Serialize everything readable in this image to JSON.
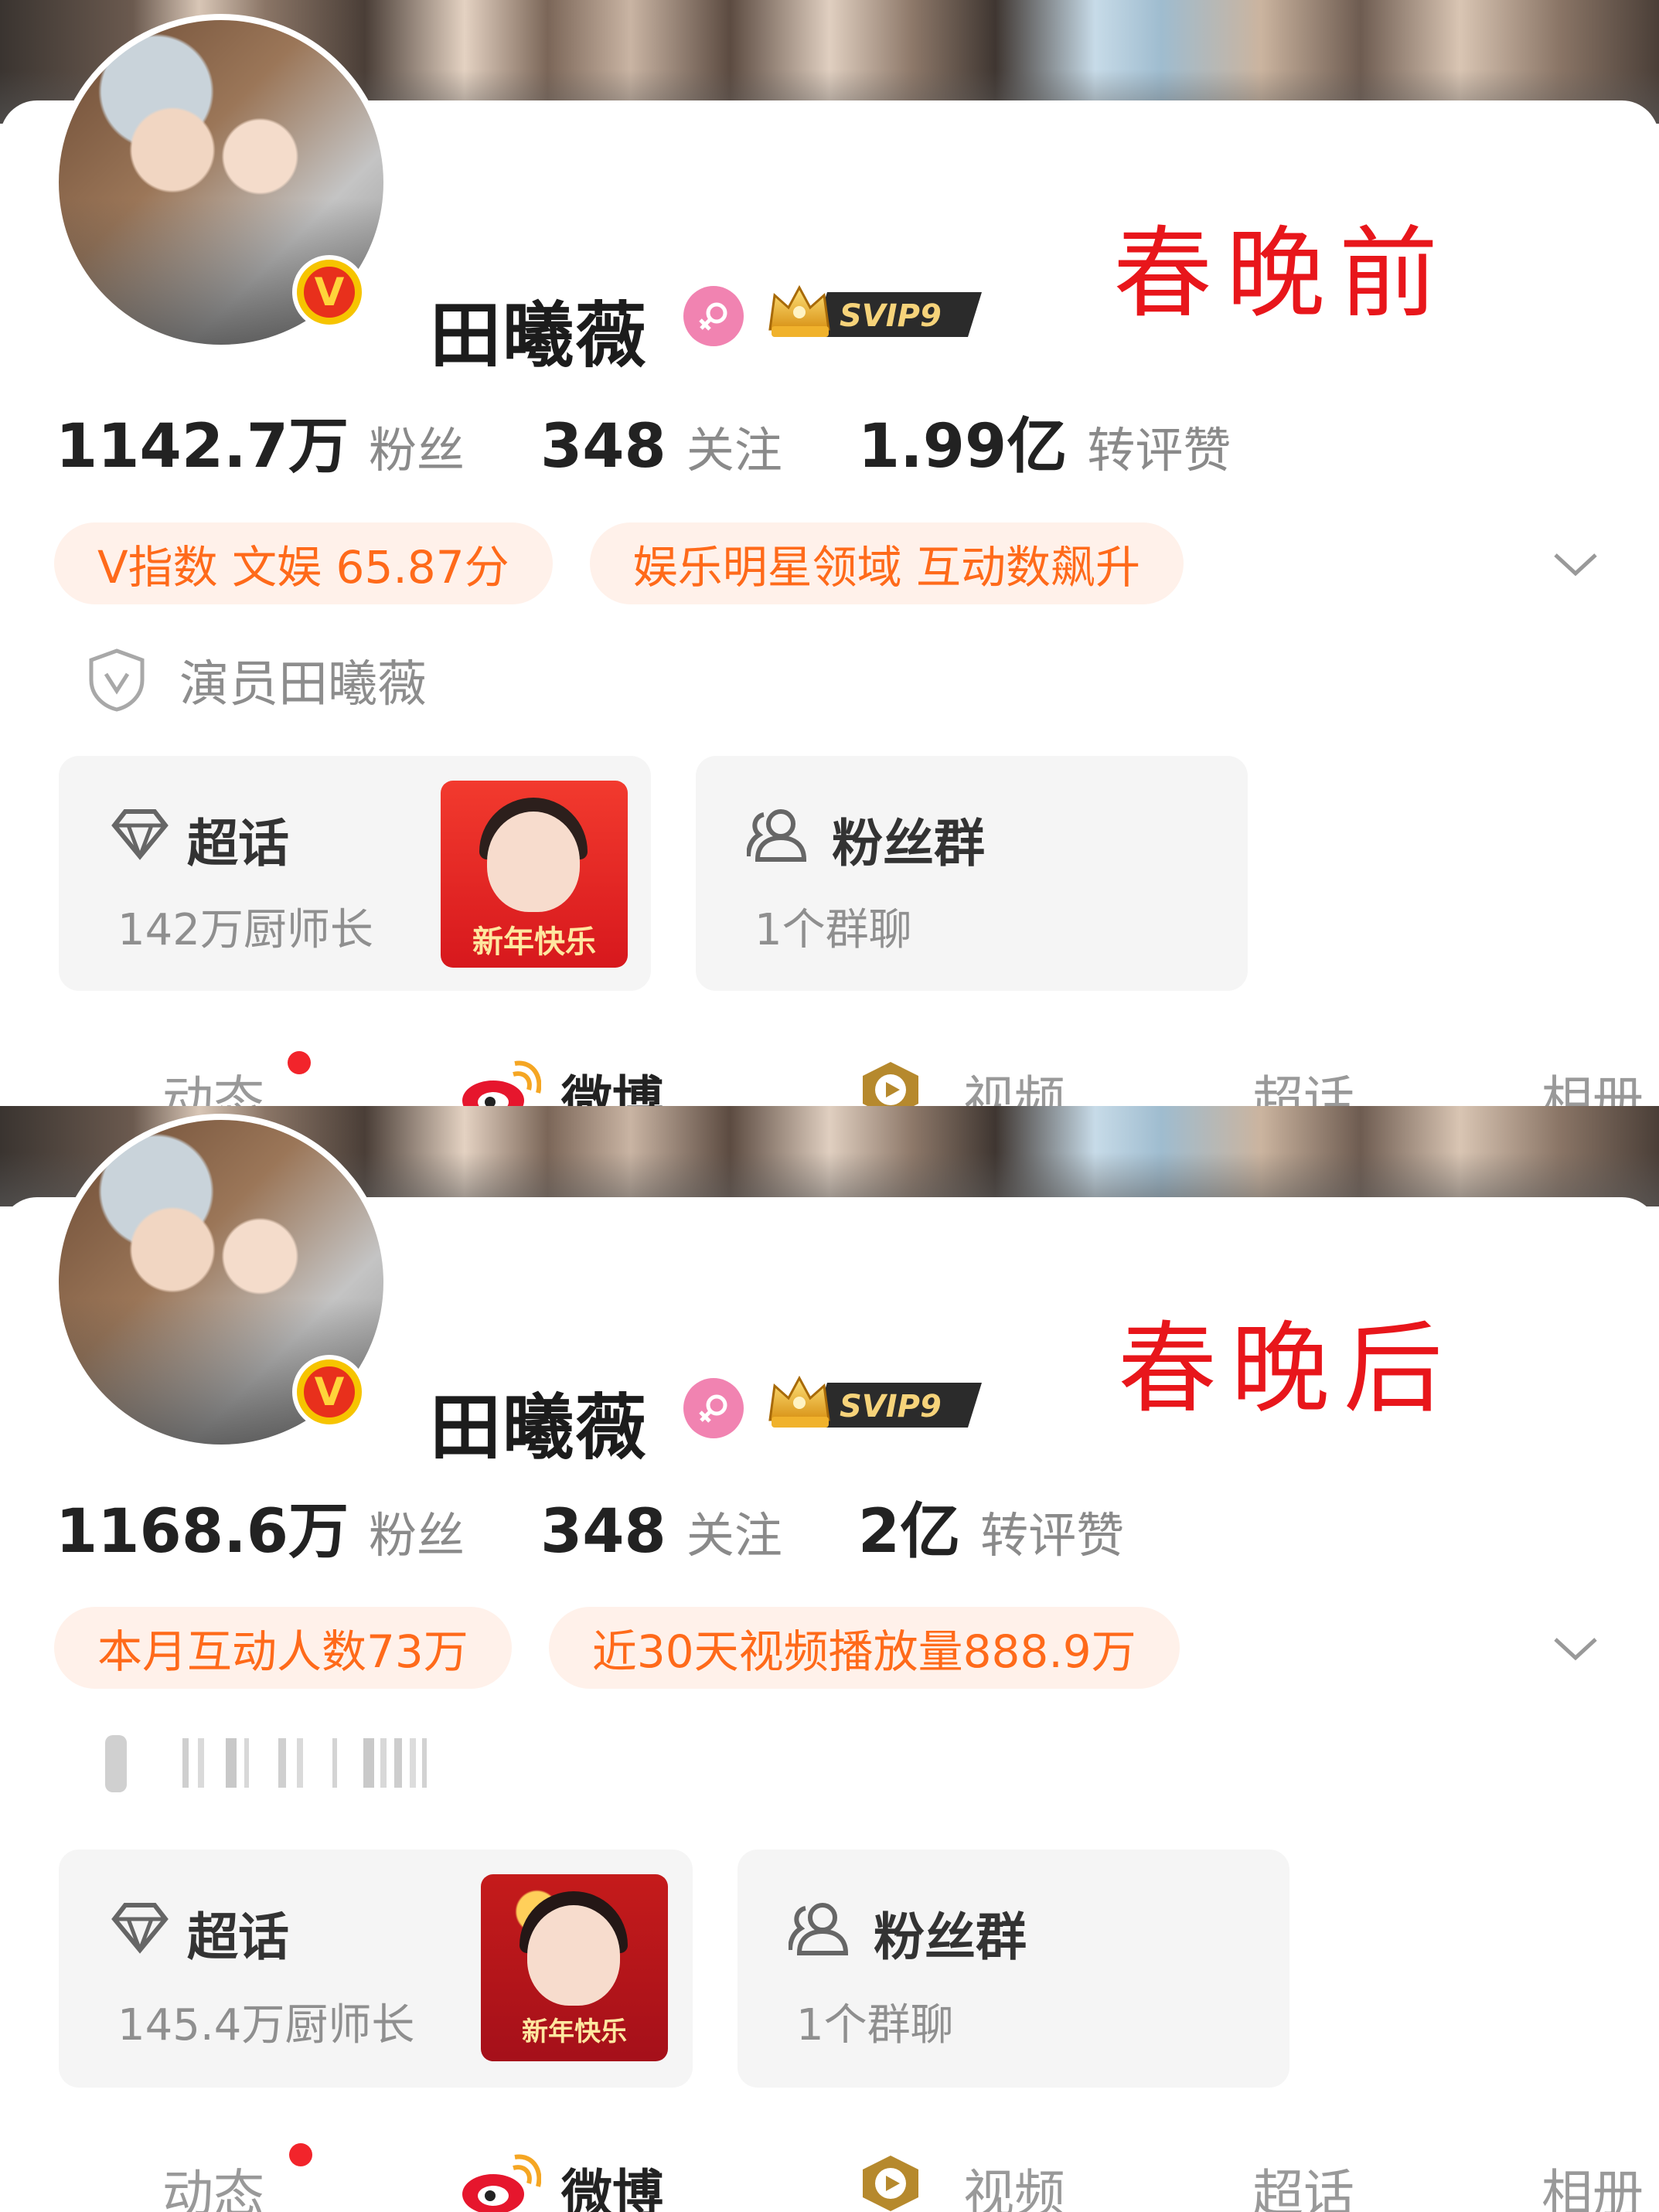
{
  "colors": {
    "accent_orange": "#ff6a1a",
    "tag_bg": "#fff1ea",
    "handwriting_red": "#e8161b",
    "vip_gold": "#f6c400"
  },
  "before": {
    "annotation": "春晚前",
    "profile": {
      "name": "田曦薇",
      "vip_badge": "SVIP9"
    },
    "stats": [
      {
        "value": "1142.7万",
        "label": "粉丝"
      },
      {
        "value": "348",
        "label": "关注"
      },
      {
        "value": "1.99亿",
        "label": "转评赞"
      }
    ],
    "tags": [
      "V指数 文娱 65.87分",
      "娱乐明星领域 互动数飙升"
    ],
    "certification": "演员田曦薇",
    "supertopic": {
      "title": "超话",
      "subtitle": "142万厨师长",
      "thumb_caption": "新年快乐"
    },
    "fan_group": {
      "title": "粉丝群",
      "subtitle": "1个群聊"
    },
    "tabs": [
      "动态",
      "微博",
      "视频",
      "超话",
      "相册"
    ]
  },
  "after": {
    "annotation": "春晚后",
    "profile": {
      "name": "田曦薇",
      "vip_badge": "SVIP9"
    },
    "stats": [
      {
        "value": "1168.6万",
        "label": "粉丝"
      },
      {
        "value": "348",
        "label": "关注"
      },
      {
        "value": "2亿",
        "label": "转评赞"
      }
    ],
    "tags": [
      "本月互动人数73万",
      "近30天视频播放量888.9万"
    ],
    "supertopic": {
      "title": "超话",
      "subtitle": "145.4万厨师长",
      "thumb_caption": "新年快乐"
    },
    "fan_group": {
      "title": "粉丝群",
      "subtitle": "1个群聊"
    },
    "tabs": [
      "动态",
      "微博",
      "视频",
      "超话",
      "相册"
    ]
  }
}
